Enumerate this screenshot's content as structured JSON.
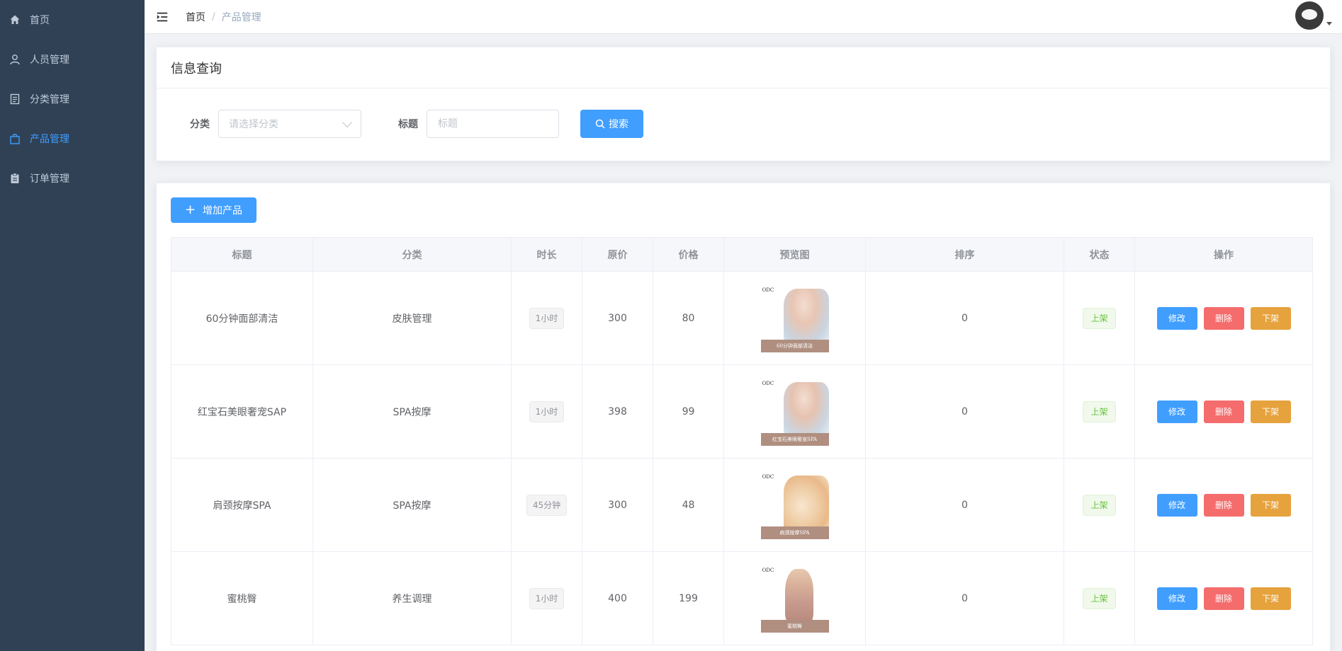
{
  "sidebar": {
    "items": [
      {
        "label": "首页",
        "icon": "home-icon",
        "active": false
      },
      {
        "label": "人员管理",
        "icon": "user-icon",
        "active": false
      },
      {
        "label": "分类管理",
        "icon": "document-icon",
        "active": false
      },
      {
        "label": "产品管理",
        "icon": "shopping-bag-icon",
        "active": true
      },
      {
        "label": "订单管理",
        "icon": "clipboard-icon",
        "active": false
      }
    ]
  },
  "navbar": {
    "breadcrumb": {
      "home": "首页",
      "separator": "/",
      "current": "产品管理"
    }
  },
  "query": {
    "title": "信息查询",
    "category_label": "分类",
    "category_placeholder": "请选择分类",
    "title_label": "标题",
    "title_placeholder": "标题",
    "search_label": "搜索"
  },
  "list": {
    "add_label": "增加产品",
    "columns": [
      "标题",
      "分类",
      "时长",
      "原价",
      "价格",
      "预览图",
      "排序",
      "状态",
      "操作"
    ],
    "rows": [
      {
        "title": "60分钟面部清洁",
        "category": "皮肤管理",
        "duration": "1小时",
        "original_price": "300",
        "price": "80",
        "preview_brand": "ODC",
        "preview_caption": "60分钟面部清洁",
        "sort": "0",
        "status": "上架"
      },
      {
        "title": "红宝石美眼奢宠SAP",
        "category": "SPA按摩",
        "duration": "1小时",
        "original_price": "398",
        "price": "99",
        "preview_brand": "ODC",
        "preview_caption": "红宝石美眼奢宠SPA",
        "sort": "0",
        "status": "上架"
      },
      {
        "title": "肩颈按摩SPA",
        "category": "SPA按摩",
        "duration": "45分钟",
        "original_price": "300",
        "price": "48",
        "preview_brand": "ODC",
        "preview_caption": "肩颈按摩SPA",
        "sort": "0",
        "status": "上架"
      },
      {
        "title": "蜜桃臀",
        "category": "养生调理",
        "duration": "1小时",
        "original_price": "400",
        "price": "199",
        "preview_brand": "ODC",
        "preview_caption": "蜜桃臀",
        "sort": "0",
        "status": "上架"
      }
    ],
    "actions": {
      "edit": "修改",
      "delete": "删除",
      "off_shelf": "下架"
    }
  },
  "colors": {
    "sidebar_bg": "#304156",
    "primary": "#409EFF",
    "danger": "#f56c6c",
    "warning": "#e6a23c",
    "success": "#67c23a"
  }
}
